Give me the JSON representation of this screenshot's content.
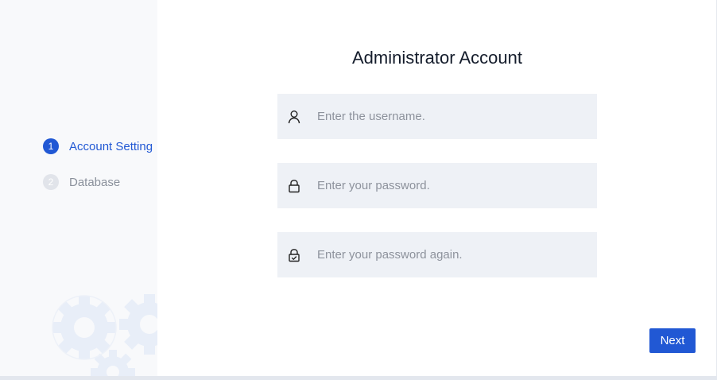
{
  "sidebar": {
    "steps": [
      {
        "number": "1",
        "label": "Account Setting",
        "state": "active"
      },
      {
        "number": "2",
        "label": "Database",
        "state": "inactive"
      }
    ],
    "decoration_icon": "gears-icon"
  },
  "main": {
    "title": "Administrator Account",
    "fields": {
      "username": {
        "placeholder": "Enter the username.",
        "value": "",
        "icon": "user-icon"
      },
      "password": {
        "placeholder": "Enter your password.",
        "value": "",
        "icon": "lock-icon"
      },
      "confirm_password": {
        "placeholder": "Enter your password again.",
        "value": "",
        "icon": "lock-check-icon"
      }
    },
    "next_label": "Next"
  },
  "colors": {
    "accent": "#2158d4",
    "field_background": "#eef1f6",
    "sidebar_background": "#f8f9fb",
    "inactive_step": "#e1e4ea"
  }
}
